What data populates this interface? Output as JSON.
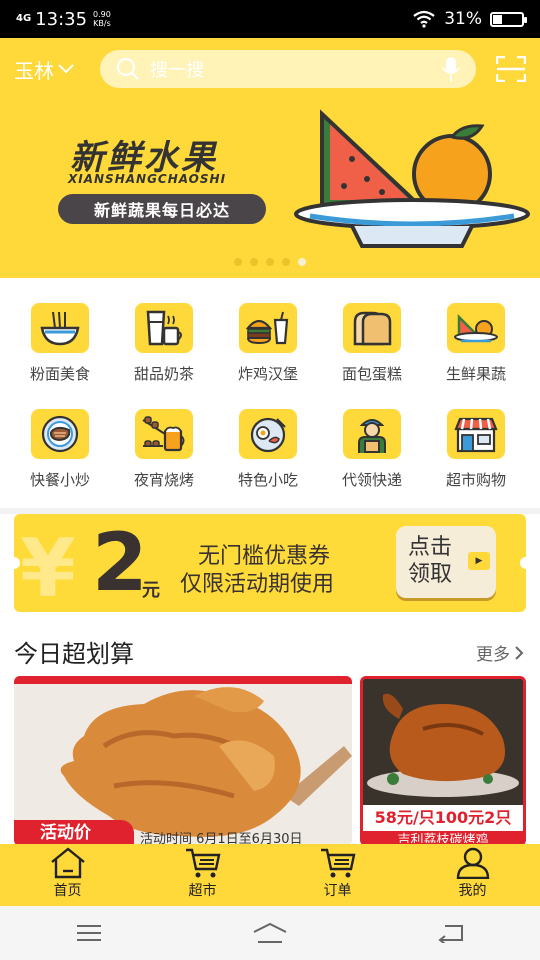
{
  "status_bar": {
    "network": "4G",
    "time": "13:35",
    "speed_value": "0.90",
    "speed_unit": "KB/s",
    "battery": "31%",
    "battery_level": 0.31
  },
  "header": {
    "city": "玉林",
    "search_placeholder": "搜一搜",
    "icons": [
      "chevron-down-icon",
      "search-icon",
      "microphone-icon",
      "scan-icon"
    ]
  },
  "banner": {
    "title": "新鲜水果",
    "subtitle": "XIANSHANGCHAOSHI",
    "slogan": "新鲜蔬果每日必达",
    "slide_count": 5,
    "active_slide": 5
  },
  "categories": [
    {
      "label": "粉面美食",
      "icon": "noodle-bowl-icon"
    },
    {
      "label": "甜品奶茶",
      "icon": "milk-tea-icon"
    },
    {
      "label": "炸鸡汉堡",
      "icon": "burger-icon"
    },
    {
      "label": "面包蛋糕",
      "icon": "bread-icon"
    },
    {
      "label": "生鲜果蔬",
      "icon": "fruit-plate-icon"
    },
    {
      "label": "快餐小炒",
      "icon": "steak-plate-icon"
    },
    {
      "label": "夜宵烧烤",
      "icon": "bbq-beer-icon"
    },
    {
      "label": "特色小吃",
      "icon": "snack-plate-icon"
    },
    {
      "label": "代领快递",
      "icon": "courier-icon"
    },
    {
      "label": "超市购物",
      "icon": "store-icon"
    }
  ],
  "coupon": {
    "amount": "2",
    "unit": "元",
    "line1": "无门槛优惠券",
    "line2": "仅限活动期使用",
    "button": "点击领取"
  },
  "deals": {
    "title": "今日超划算",
    "more": "更多",
    "card1": {
      "tag": "活动价",
      "caption": "活动时间 6月1日至6月30日"
    },
    "card2": {
      "price": "58元/只100元2只",
      "name": "吉利荔枝碳烤鸡"
    }
  },
  "tabbar": [
    {
      "label": "首页",
      "icon": "home-icon"
    },
    {
      "label": "超市",
      "icon": "cart-icon"
    },
    {
      "label": "订单",
      "icon": "cart-icon"
    },
    {
      "label": "我的",
      "icon": "person-icon"
    }
  ],
  "colors": {
    "brand_yellow": "#ffd83a",
    "accent_red": "#e0222e",
    "dark_text": "#3a3230"
  }
}
